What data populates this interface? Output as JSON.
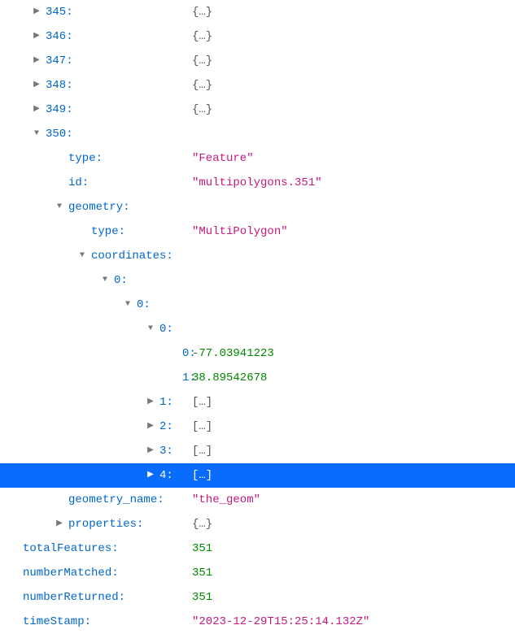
{
  "rows": [
    {
      "depth": 0,
      "toggle": "closed",
      "key": "345",
      "valueType": "collapsed",
      "value": "{…}"
    },
    {
      "depth": 0,
      "toggle": "closed",
      "key": "346",
      "valueType": "collapsed",
      "value": "{…}"
    },
    {
      "depth": 0,
      "toggle": "closed",
      "key": "347",
      "valueType": "collapsed",
      "value": "{…}"
    },
    {
      "depth": 0,
      "toggle": "closed",
      "key": "348",
      "valueType": "collapsed",
      "value": "{…}"
    },
    {
      "depth": 0,
      "toggle": "closed",
      "key": "349",
      "valueType": "collapsed",
      "value": "{…}"
    },
    {
      "depth": 0,
      "toggle": "open",
      "key": "350",
      "valueType": "none",
      "value": ""
    },
    {
      "depth": 1,
      "toggle": "none",
      "key": "type",
      "valueType": "string",
      "value": "\"Feature\""
    },
    {
      "depth": 1,
      "toggle": "none",
      "key": "id",
      "valueType": "string",
      "value": "\"multipolygons.351\""
    },
    {
      "depth": 1,
      "toggle": "open",
      "key": "geometry",
      "valueType": "none",
      "value": ""
    },
    {
      "depth": 2,
      "toggle": "none",
      "key": "type",
      "valueType": "string",
      "value": "\"MultiPolygon\""
    },
    {
      "depth": 2,
      "toggle": "open",
      "key": "coordinates",
      "valueType": "none",
      "value": ""
    },
    {
      "depth": 3,
      "toggle": "open",
      "key": "0",
      "valueType": "none",
      "value": ""
    },
    {
      "depth": 4,
      "toggle": "open",
      "key": "0",
      "valueType": "none",
      "value": ""
    },
    {
      "depth": 5,
      "toggle": "open",
      "key": "0",
      "valueType": "none",
      "value": ""
    },
    {
      "depth": 6,
      "toggle": "none",
      "key": "0",
      "valueType": "number",
      "value": "-77.03941223"
    },
    {
      "depth": 6,
      "toggle": "none",
      "key": "1",
      "valueType": "number",
      "value": "38.89542678"
    },
    {
      "depth": 5,
      "toggle": "closed",
      "key": "1",
      "valueType": "collapsed",
      "value": "[…]"
    },
    {
      "depth": 5,
      "toggle": "closed",
      "key": "2",
      "valueType": "collapsed",
      "value": "[…]"
    },
    {
      "depth": 5,
      "toggle": "closed",
      "key": "3",
      "valueType": "collapsed",
      "value": "[…]"
    },
    {
      "depth": 5,
      "toggle": "closed",
      "key": "4",
      "valueType": "collapsed",
      "value": "[…]",
      "selected": true
    },
    {
      "depth": 1,
      "toggle": "none",
      "key": "geometry_name",
      "valueType": "string",
      "value": "\"the_geom\""
    },
    {
      "depth": 1,
      "toggle": "closed",
      "key": "properties",
      "valueType": "collapsed",
      "value": "{…}"
    },
    {
      "depth": -1,
      "toggle": "none",
      "key": "totalFeatures",
      "valueType": "number",
      "value": "351"
    },
    {
      "depth": -1,
      "toggle": "none",
      "key": "numberMatched",
      "valueType": "number",
      "value": "351"
    },
    {
      "depth": -1,
      "toggle": "none",
      "key": "numberReturned",
      "valueType": "number",
      "value": "351"
    },
    {
      "depth": -1,
      "toggle": "none",
      "key": "timeStamp",
      "valueType": "string",
      "value": "\"2023-12-29T15:25:14.132Z\""
    }
  ],
  "glyphs": {
    "closed": "▶",
    "open": "▼",
    "none": ""
  }
}
